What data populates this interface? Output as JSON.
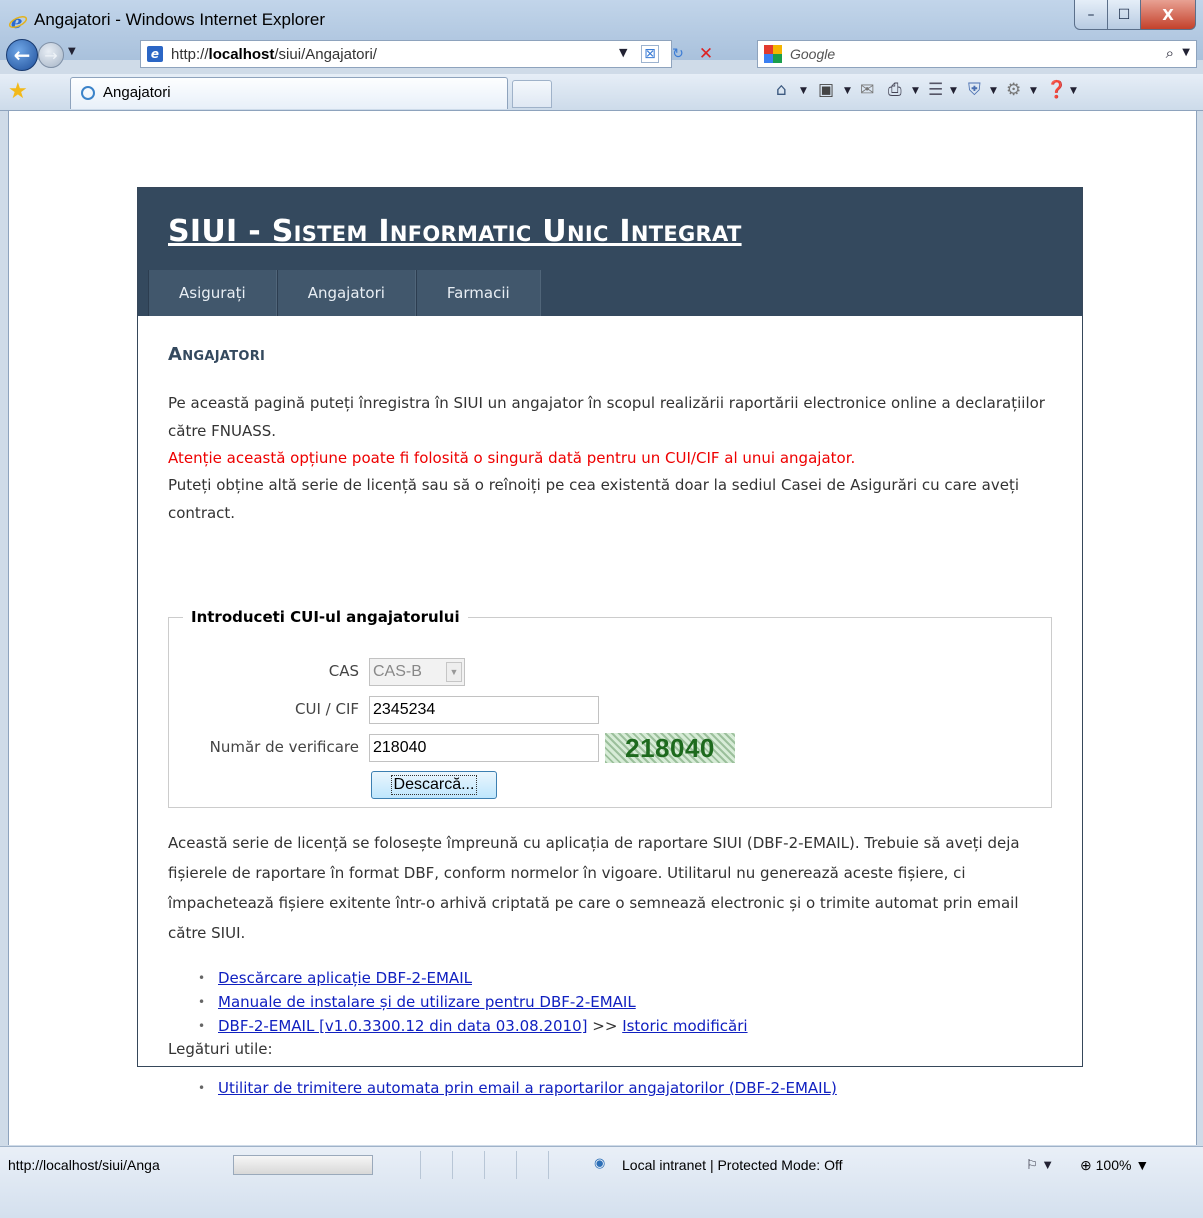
{
  "window": {
    "title": "Angajatori - Windows Internet Explorer",
    "minimize": "–",
    "maximize": "☐",
    "close": "X"
  },
  "address_bar": {
    "url_prefix": "http://",
    "url_host": "localhost",
    "url_path": "/siui/Angajatori/",
    "dropdown": "▼"
  },
  "search": {
    "provider": "Google",
    "go": "⌕",
    "dropdown": "▼"
  },
  "tab": {
    "label": "Angajatori"
  },
  "site": {
    "title": "SIUI - Sistem Informatic Unic Integrat",
    "menu": [
      "Asigurați",
      "Angajatori",
      "Farmacii"
    ]
  },
  "page": {
    "heading": "Angajatori",
    "intro": "Pe această pagină puteți înregistra în SIUI un angajator în scopul realizării raportării electronice online a declarațiilor către FNUASS.",
    "warning": "Atenție această opțiune poate fi folosită o singură dată pentru un CUI/CIF al unui angajator.",
    "note": "Puteți obține altă serie de licență sau să o reînoiți pe cea existentă doar la sediul Casei de Asigurări cu care aveți contract.",
    "form": {
      "legend": "Introduceti CUI-ul angajatorului",
      "cas_label": "CAS",
      "cas_value": "CAS-B",
      "cui_label": "CUI / CIF",
      "cui_value": "2345234",
      "verif_label": "Număr de verificare",
      "verif_value": "218040",
      "captcha": "218040",
      "submit": "Descarcă..."
    },
    "info": "Această serie de licență se folosește împreună cu aplicația de raportare SIUI (DBF-2-EMAIL). Trebuie să aveți deja fișierele de raportare în format DBF, conform normelor în vigoare. Utilitarul nu generează aceste fișiere, ci împachetează fișiere exitente într-o arhivă criptată pe care o semnează electronic și o trimite automat prin email către SIUI.",
    "links": {
      "download_app": "Descărcare aplicație DBF-2-EMAIL",
      "manuals": "Manuale de instalare și de utilizare pentru DBF-2-EMAIL",
      "version": "DBF-2-EMAIL [v1.0.3300.12 din data 03.08.2010]",
      "separator": ">>",
      "history": "Istoric modificări"
    },
    "useful_label": "Legături utile:",
    "useful_link": "Utilitar de trimitere automata prin email a raportarilor angajatorilor (DBF-2-EMAIL)"
  },
  "status_bar": {
    "url": "http://localhost/siui/Anga",
    "zone": "Local intranet | Protected Mode: Off",
    "zoom": "100%"
  },
  "colors": {
    "header_bg": "#34495e",
    "warning": "#e00000",
    "link": "#1020c0"
  }
}
